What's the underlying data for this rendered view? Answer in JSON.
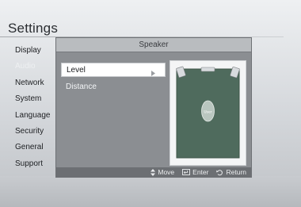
{
  "screen": {
    "title": "Settings"
  },
  "menu": {
    "items": [
      {
        "label": "Display",
        "active": false
      },
      {
        "label": "Audio",
        "active": true
      },
      {
        "label": "Network",
        "active": false
      },
      {
        "label": "System",
        "active": false
      },
      {
        "label": "Language",
        "active": false
      },
      {
        "label": "Security",
        "active": false
      },
      {
        "label": "General",
        "active": false
      },
      {
        "label": "Support",
        "active": false
      }
    ]
  },
  "dialog": {
    "title": "Speaker",
    "options": [
      {
        "label": "Level",
        "selected": true,
        "has_submenu": true
      },
      {
        "label": "Distance",
        "selected": false,
        "has_submenu": false
      }
    ],
    "preview": {
      "user_label": "User"
    },
    "footer": {
      "move_label": "Move",
      "enter_label": "Enter",
      "return_label": "Return"
    }
  },
  "colors": {
    "dialog_body": "#8b8e92",
    "dialog_header": "#b9bcbf",
    "footer_bar": "#6c6f73",
    "selected_option": "#ffffff",
    "room_preview": "#4f6b5d"
  }
}
